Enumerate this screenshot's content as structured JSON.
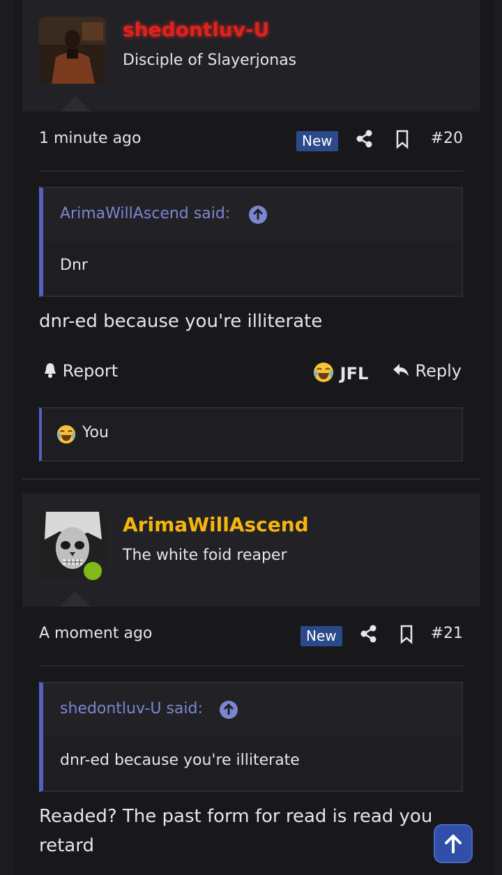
{
  "post1": {
    "username": "shedontluv-U",
    "user_title": "Disciple of Slayerjonas",
    "time": "1 minute ago",
    "badge": "New",
    "number": "#20",
    "quote": {
      "author_label": "ArimaWillAscend said:",
      "text": "Dnr"
    },
    "message": "dnr-ed because you're illiterate",
    "actions": {
      "report": "Report",
      "reaction": "JFL",
      "reply": "Reply"
    },
    "reactions_summary": "You"
  },
  "post2": {
    "username": "ArimaWillAscend",
    "user_title": "The white foid reaper",
    "time": "A moment ago",
    "badge": "New",
    "number": "#21",
    "quote": {
      "author_label": "shedontluv-U said:",
      "text": "dnr-ed because you're illiterate"
    },
    "message": "Readed? The past form for read is read you retard"
  },
  "colors": {
    "username1": "#e0211d",
    "username2": "#f5b50f",
    "online": "#7fba18",
    "accent": "#5560c0",
    "new_badge": "#2b4a8c"
  },
  "icons": [
    "share-icon",
    "bookmark-icon",
    "arrow-up-circle-icon",
    "bell-icon",
    "reply-icon",
    "crying-laughing-emoji",
    "arrow-up-icon"
  ]
}
